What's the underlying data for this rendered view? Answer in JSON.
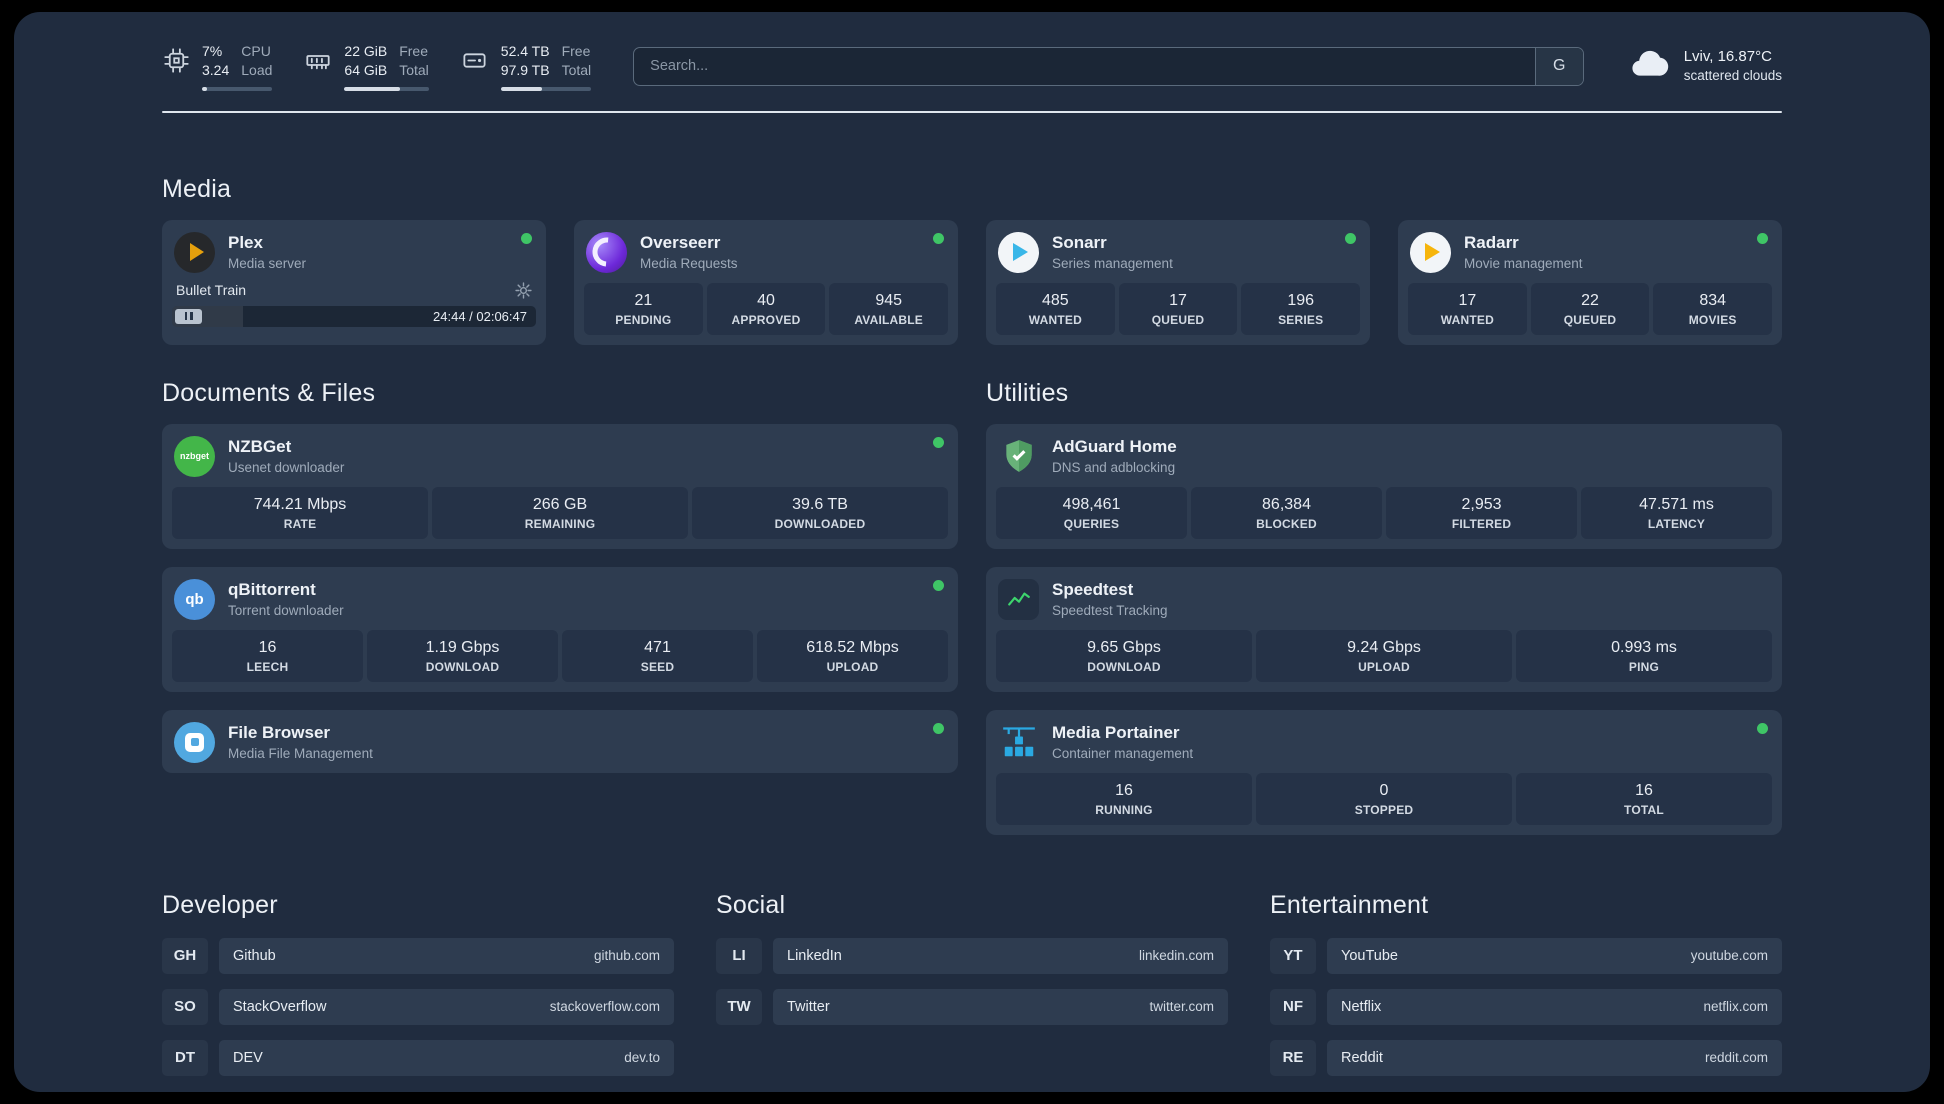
{
  "colors": {
    "online_dot": "#3fc566",
    "plex_amber": "#e5a00d",
    "sonarr_blue": "#38b6e8",
    "radarr_amber": "#f6b50c",
    "nzbget_green": "#43b649",
    "adguard_green": "#68b279",
    "portainer_blue": "#2aa9e2",
    "page_background": "#202c3f",
    "card_background": "#2e3c50"
  },
  "topbar": {
    "metrics": [
      {
        "icon": "cpu",
        "value_top": "7%",
        "value_bottom": "3.24",
        "label_top": "CPU",
        "label_bottom": "Load",
        "bar": "7%"
      },
      {
        "icon": "ram",
        "value_top": "22 GiB",
        "value_bottom": "64 GiB",
        "label_top": "Free",
        "label_bottom": "Total",
        "bar": "66%"
      },
      {
        "icon": "disk",
        "value_top": "52.4 TB",
        "value_bottom": "97.9 TB",
        "label_top": "Free",
        "label_bottom": "Total",
        "bar": "46%"
      }
    ],
    "search": {
      "placeholder": "Search...",
      "engine": "G"
    },
    "weather": {
      "location": "Lviv, 16.87°C",
      "condition": "scattered clouds"
    }
  },
  "media": {
    "title": "Media",
    "plex": {
      "name": "Plex",
      "subtitle": "Media server",
      "track": "Bullet Train",
      "time": "24:44 / 02:06:47",
      "progress": "19.5%"
    },
    "overseerr": {
      "name": "Overseerr",
      "subtitle": "Media Requests",
      "stats": [
        {
          "value": "21",
          "label": "PENDING"
        },
        {
          "value": "40",
          "label": "APPROVED"
        },
        {
          "value": "945",
          "label": "AVAILABLE"
        }
      ]
    },
    "sonarr": {
      "name": "Sonarr",
      "subtitle": "Series management",
      "stats": [
        {
          "value": "485",
          "label": "WANTED"
        },
        {
          "value": "17",
          "label": "QUEUED"
        },
        {
          "value": "196",
          "label": "SERIES"
        }
      ]
    },
    "radarr": {
      "name": "Radarr",
      "subtitle": "Movie management",
      "stats": [
        {
          "value": "17",
          "label": "WANTED"
        },
        {
          "value": "22",
          "label": "QUEUED"
        },
        {
          "value": "834",
          "label": "MOVIES"
        }
      ]
    }
  },
  "documents": {
    "title": "Documents & Files",
    "nzbget": {
      "name": "NZBGet",
      "subtitle": "Usenet downloader",
      "icon_text": "nzbget",
      "stats": [
        {
          "value": "744.21 Mbps",
          "label": "RATE"
        },
        {
          "value": "266 GB",
          "label": "REMAINING"
        },
        {
          "value": "39.6 TB",
          "label": "DOWNLOADED"
        }
      ]
    },
    "qbittorrent": {
      "name": "qBittorrent",
      "subtitle": "Torrent downloader",
      "icon_text": "qb",
      "stats": [
        {
          "value": "16",
          "label": "LEECH"
        },
        {
          "value": "1.19 Gbps",
          "label": "DOWNLOAD"
        },
        {
          "value": "471",
          "label": "SEED"
        },
        {
          "value": "618.52 Mbps",
          "label": "UPLOAD"
        }
      ]
    },
    "filebrowser": {
      "name": "File Browser",
      "subtitle": "Media File Management"
    }
  },
  "utilities": {
    "title": "Utilities",
    "adguard": {
      "name": "AdGuard Home",
      "subtitle": "DNS and adblocking",
      "stats": [
        {
          "value": "498,461",
          "label": "QUERIES"
        },
        {
          "value": "86,384",
          "label": "BLOCKED"
        },
        {
          "value": "2,953",
          "label": "FILTERED"
        },
        {
          "value": "47.571 ms",
          "label": "LATENCY"
        }
      ]
    },
    "speedtest": {
      "name": "Speedtest",
      "subtitle": "Speedtest Tracking",
      "stats": [
        {
          "value": "9.65 Gbps",
          "label": "DOWNLOAD"
        },
        {
          "value": "9.24 Gbps",
          "label": "UPLOAD"
        },
        {
          "value": "0.993 ms",
          "label": "PING"
        }
      ]
    },
    "portainer": {
      "name": "Media Portainer",
      "subtitle": "Container management",
      "stats": [
        {
          "value": "16",
          "label": "RUNNING"
        },
        {
          "value": "0",
          "label": "STOPPED"
        },
        {
          "value": "16",
          "label": "TOTAL"
        }
      ]
    }
  },
  "bookmarks": [
    {
      "title": "Developer",
      "items": [
        {
          "abbr": "GH",
          "name": "Github",
          "url": "github.com"
        },
        {
          "abbr": "SO",
          "name": "StackOverflow",
          "url": "stackoverflow.com"
        },
        {
          "abbr": "DT",
          "name": "DEV",
          "url": "dev.to"
        }
      ]
    },
    {
      "title": "Social",
      "items": [
        {
          "abbr": "LI",
          "name": "LinkedIn",
          "url": "linkedin.com"
        },
        {
          "abbr": "TW",
          "name": "Twitter",
          "url": "twitter.com"
        }
      ]
    },
    {
      "title": "Entertainment",
      "items": [
        {
          "abbr": "YT",
          "name": "YouTube",
          "url": "youtube.com"
        },
        {
          "abbr": "NF",
          "name": "Netflix",
          "url": "netflix.com"
        },
        {
          "abbr": "RE",
          "name": "Reddit",
          "url": "reddit.com"
        }
      ]
    }
  ]
}
